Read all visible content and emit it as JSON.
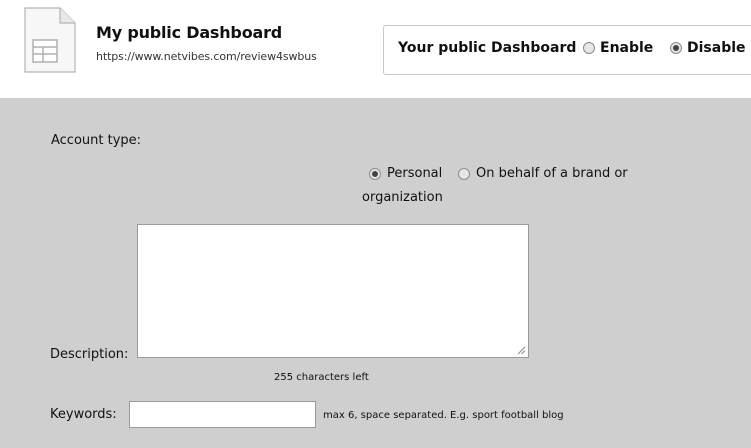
{
  "header": {
    "title": "My public Dashboard",
    "url": "https://www.netvibes.com/review4swbus"
  },
  "public_toggle": {
    "label": "Your public Dashboard",
    "options": [
      {
        "label": "Enable",
        "selected": false
      },
      {
        "label": "Disable",
        "selected": true
      }
    ]
  },
  "form": {
    "account_type_label": "Account type:",
    "account_options": [
      {
        "label": "Personal",
        "selected": true
      },
      {
        "label": "On behalf of a brand or",
        "selected": false
      }
    ],
    "account_option_wrap": "organization",
    "description_label": "Description:",
    "description_value": "",
    "characters_left": "255 characters left",
    "keywords_label": "Keywords:",
    "keywords_value": "",
    "keywords_hint": "max 6, space separated. E.g. sport football blog"
  },
  "icons": {
    "page": "document-icon",
    "resize": "resize-grip-icon"
  },
  "colors": {
    "panel_background": "#cfcfcf",
    "header_background": "#ffffff"
  }
}
